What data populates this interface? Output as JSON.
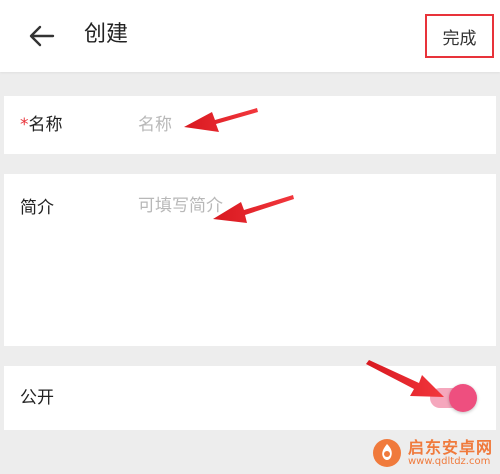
{
  "header": {
    "title": "创建",
    "done_label": "完成",
    "back_icon": "arrow-left-icon"
  },
  "form": {
    "name": {
      "required_mark": "*",
      "label": "名称",
      "placeholder": "名称",
      "value": ""
    },
    "intro": {
      "label": "简介",
      "placeholder": "可填写简介",
      "value": ""
    },
    "public": {
      "label": "公开",
      "enabled": true
    }
  },
  "watermark": {
    "name": "启东安卓网",
    "url": "www.qdltdz.com"
  },
  "colors": {
    "accent_red": "#e8333a",
    "toggle_track": "#f5a7bd",
    "toggle_knob": "#ee4f7f",
    "watermark_orange": "#f07a3c"
  }
}
